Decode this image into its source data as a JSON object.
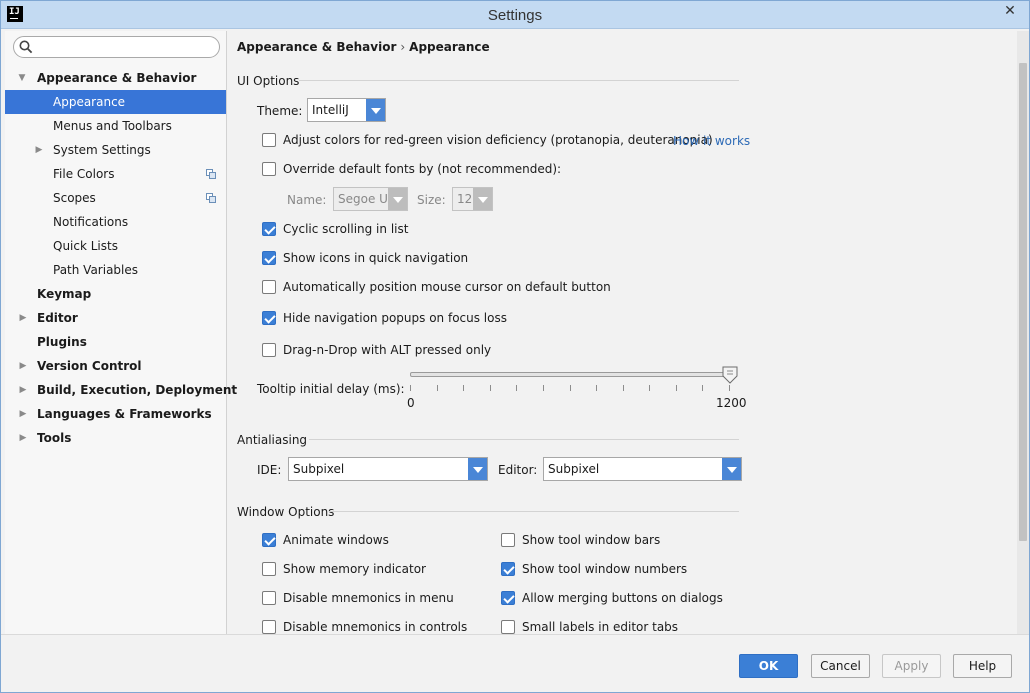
{
  "window": {
    "title": "Settings",
    "app_icon": "IJ"
  },
  "search": {
    "value": "",
    "placeholder": ""
  },
  "sidebar": {
    "items": [
      {
        "label": "Appearance & Behavior",
        "bold": true,
        "expanded": true,
        "level": 0
      },
      {
        "label": "Appearance",
        "selected": true,
        "level": 1
      },
      {
        "label": "Menus and Toolbars",
        "level": 1
      },
      {
        "label": "System Settings",
        "level": 1,
        "collapsed": true
      },
      {
        "label": "File Colors",
        "level": 1,
        "project_icon": true
      },
      {
        "label": "Scopes",
        "level": 1,
        "project_icon": true
      },
      {
        "label": "Notifications",
        "level": 1
      },
      {
        "label": "Quick Lists",
        "level": 1
      },
      {
        "label": "Path Variables",
        "level": 1
      },
      {
        "label": "Keymap",
        "bold": true,
        "level": 0
      },
      {
        "label": "Editor",
        "bold": true,
        "level": 0,
        "collapsed": true
      },
      {
        "label": "Plugins",
        "bold": true,
        "level": 0
      },
      {
        "label": "Version Control",
        "bold": true,
        "level": 0,
        "collapsed": true
      },
      {
        "label": "Build, Execution, Deployment",
        "bold": true,
        "level": 0,
        "collapsed": true
      },
      {
        "label": "Languages & Frameworks",
        "bold": true,
        "level": 0,
        "collapsed": true
      },
      {
        "label": "Tools",
        "bold": true,
        "level": 0,
        "collapsed": true
      }
    ]
  },
  "breadcrumb": {
    "parent": "Appearance & Behavior",
    "separator": "›",
    "current": "Appearance"
  },
  "ui_options": {
    "title": "UI Options",
    "theme_label": "Theme:",
    "theme_value": "IntelliJ",
    "adjust_colors": {
      "label": "Adjust colors for red-green vision deficiency (protanopia, deuteranopia)",
      "checked": false,
      "link": "How it works"
    },
    "override_fonts": {
      "label": "Override default fonts by (not recommended):",
      "checked": false
    },
    "font_name_label": "Name:",
    "font_name_value": "Segoe UI",
    "font_size_label": "Size:",
    "font_size_value": "12",
    "cyclic_scrolling": {
      "label": "Cyclic scrolling in list",
      "checked": true
    },
    "show_icons": {
      "label": "Show icons in quick navigation",
      "checked": true
    },
    "auto_mouse": {
      "label": "Automatically position mouse cursor on default button",
      "checked": false
    },
    "hide_popups": {
      "label": "Hide navigation popups on focus loss",
      "checked": true
    },
    "drag_drop": {
      "label": "Drag-n-Drop with ALT pressed only",
      "checked": false
    },
    "tooltip_label": "Tooltip initial delay (ms):",
    "tooltip_min": "0",
    "tooltip_max": "1200",
    "tooltip_value": 1200
  },
  "antialiasing": {
    "title": "Antialiasing",
    "ide_label": "IDE:",
    "ide_value": "Subpixel",
    "editor_label": "Editor:",
    "editor_value": "Subpixel"
  },
  "window_options": {
    "title": "Window Options",
    "left": [
      {
        "label": "Animate windows",
        "checked": true
      },
      {
        "label": "Show memory indicator",
        "checked": false
      },
      {
        "label": "Disable mnemonics in menu",
        "checked": false
      },
      {
        "label": "Disable mnemonics in controls",
        "checked": false
      }
    ],
    "right": [
      {
        "label": "Show tool window bars",
        "checked": false
      },
      {
        "label": "Show tool window numbers",
        "checked": true
      },
      {
        "label": "Allow merging buttons on dialogs",
        "checked": true
      },
      {
        "label": "Small labels in editor tabs",
        "checked": false
      }
    ]
  },
  "footer": {
    "ok": "OK",
    "cancel": "Cancel",
    "apply": "Apply",
    "help": "Help"
  },
  "colors": {
    "accent": "#3875d7",
    "checkbox": "#3b7fd6",
    "link": "#2d6ab6",
    "titlebar": "#c3daf2"
  }
}
